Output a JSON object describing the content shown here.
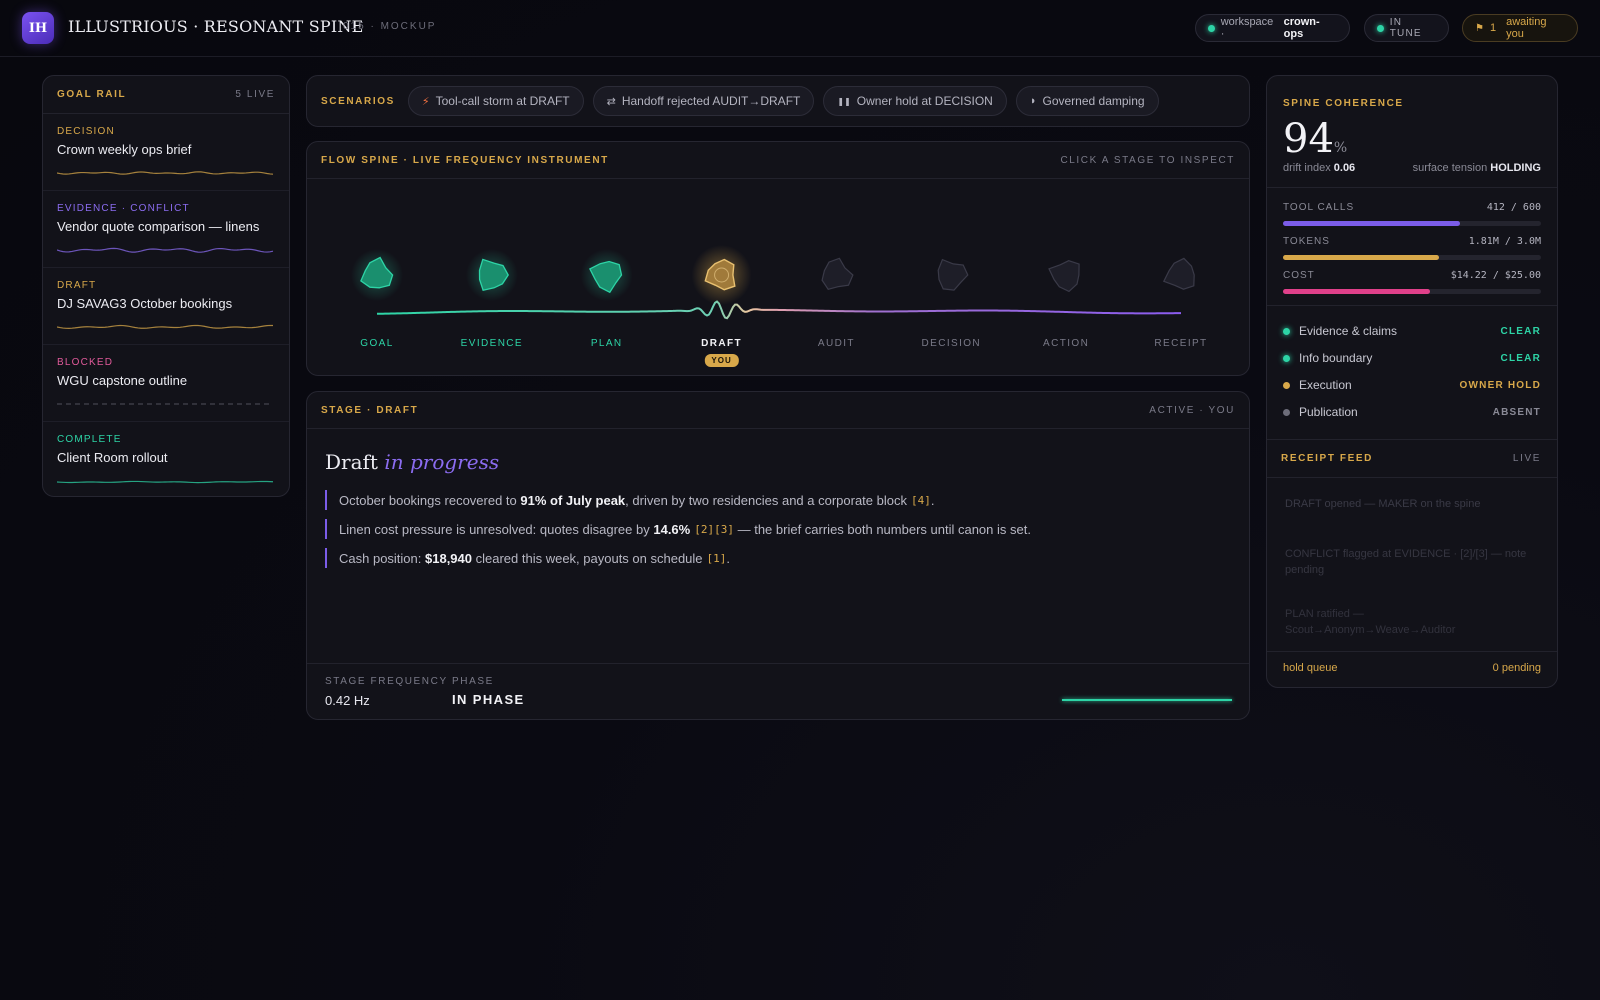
{
  "header": {
    "logo_text": "IH",
    "title": "ILLUSTRIOUS · RESONANT SPINE",
    "subtitle": "015 · MOCKUP",
    "workspace_prefix": "workspace ·",
    "workspace_name": "crown-ops",
    "tune_status": "IN TUNE",
    "awaiting_count": "1",
    "awaiting_label": "awaiting you"
  },
  "goal_rail": {
    "title": "GOAL RAIL",
    "count": "5 LIVE",
    "items": [
      {
        "kind": "DECISION",
        "title": "Crown weekly ops brief",
        "color": "#d8a84a"
      },
      {
        "kind": "EVIDENCE · CONFLICT",
        "title": "Vendor quote comparison — linens",
        "color": "#8b6cf0"
      },
      {
        "kind": "DRAFT",
        "title": "DJ SAVAG3 October bookings",
        "color": "#d8a84a"
      },
      {
        "kind": "BLOCKED",
        "title": "WGU capstone outline",
        "color": "#e05a9a"
      },
      {
        "kind": "COMPLETE",
        "title": "Client Room rollout",
        "color": "#2dd4a6"
      }
    ]
  },
  "scenarios": {
    "label": "SCENARIOS",
    "chips": [
      {
        "icon": "lightning-icon",
        "label": "Tool-call storm at DRAFT"
      },
      {
        "icon": "swap-icon",
        "label": "Handoff rejected AUDIT→DRAFT"
      },
      {
        "icon": "pause-icon",
        "label": "Owner hold at DECISION"
      },
      {
        "icon": "half-moon-icon",
        "label": "Governed damping"
      }
    ]
  },
  "flow": {
    "title": "FLOW SPINE · LIVE FREQUENCY INSTRUMENT",
    "hint": "CLICK A STAGE TO INSPECT",
    "you_badge": "YOU",
    "stages": [
      {
        "label": "GOAL",
        "state": "done"
      },
      {
        "label": "EVIDENCE",
        "state": "done"
      },
      {
        "label": "PLAN",
        "state": "done"
      },
      {
        "label": "DRAFT",
        "state": "active"
      },
      {
        "label": "AUDIT",
        "state": "pending"
      },
      {
        "label": "DECISION",
        "state": "pending"
      },
      {
        "label": "ACTION",
        "state": "pending"
      },
      {
        "label": "RECEIPT",
        "state": "pending"
      }
    ]
  },
  "stage": {
    "label": "STAGE · DRAFT",
    "status": "ACTIVE · YOU",
    "title_main": "Draft",
    "title_em": "in progress",
    "bullets": [
      {
        "pre": "October bookings recovered to ",
        "bold": "91% of July peak",
        "post": ", driven by two residencies and a corporate block",
        "cite": "[4]",
        "end": "."
      },
      {
        "pre": "Linen cost pressure is unresolved: quotes disagree by ",
        "bold": "14.6%",
        "post": "",
        "cite": "[2][3]",
        "end": " — the brief carries both numbers until canon is set."
      },
      {
        "pre": "Cash position: ",
        "bold": "$18,940",
        "post": " cleared this week, payouts on schedule",
        "cite": "[1]",
        "end": "."
      }
    ],
    "freq_label": "STAGE FREQUENCY",
    "freq_value": "0.42 Hz",
    "phase_label": "PHASE",
    "phase_value": "IN PHASE"
  },
  "coherence": {
    "label": "SPINE COHERENCE",
    "value": "94",
    "unit": "%",
    "drift_label": "drift index",
    "drift_value": "0.06",
    "tension_label": "surface tension",
    "tension_value": "HOLDING"
  },
  "budgets": [
    {
      "label": "TOOL CALLS",
      "value": "412 / 600",
      "fraction": 0.6867,
      "color": "#7b5ce8"
    },
    {
      "label": "TOKENS",
      "value": "1.81M / 3.0M",
      "fraction": 0.6033,
      "color": "#d8a84a"
    },
    {
      "label": "COST",
      "value": "$14.22 / $25.00",
      "fraction": 0.5688,
      "color": "#e0408a"
    }
  ],
  "checks": [
    {
      "label": "Evidence & claims",
      "status": "CLEAR",
      "dot": "teal",
      "color": "#2dd4a6"
    },
    {
      "label": "Info boundary",
      "status": "CLEAR",
      "dot": "teal",
      "color": "#2dd4a6"
    },
    {
      "label": "Execution",
      "status": "OWNER HOLD",
      "dot": "gold",
      "color": "#d8a84a"
    },
    {
      "label": "Publication",
      "status": "ABSENT",
      "dot": "grey",
      "color": "#8a8a96"
    }
  ],
  "receipts": {
    "label": "RECEIPT FEED",
    "status": "LIVE",
    "items": [
      {
        "text": "DRAFT opened — MAKER on the spine"
      },
      {
        "text": "CONFLICT flagged at EVIDENCE · [2]/[3] — note pending"
      },
      {
        "text": "PLAN ratified — Scout→Anonym→Weave→Auditor"
      }
    ]
  },
  "hold_queue": {
    "label": "hold queue",
    "value": "0 pending"
  }
}
